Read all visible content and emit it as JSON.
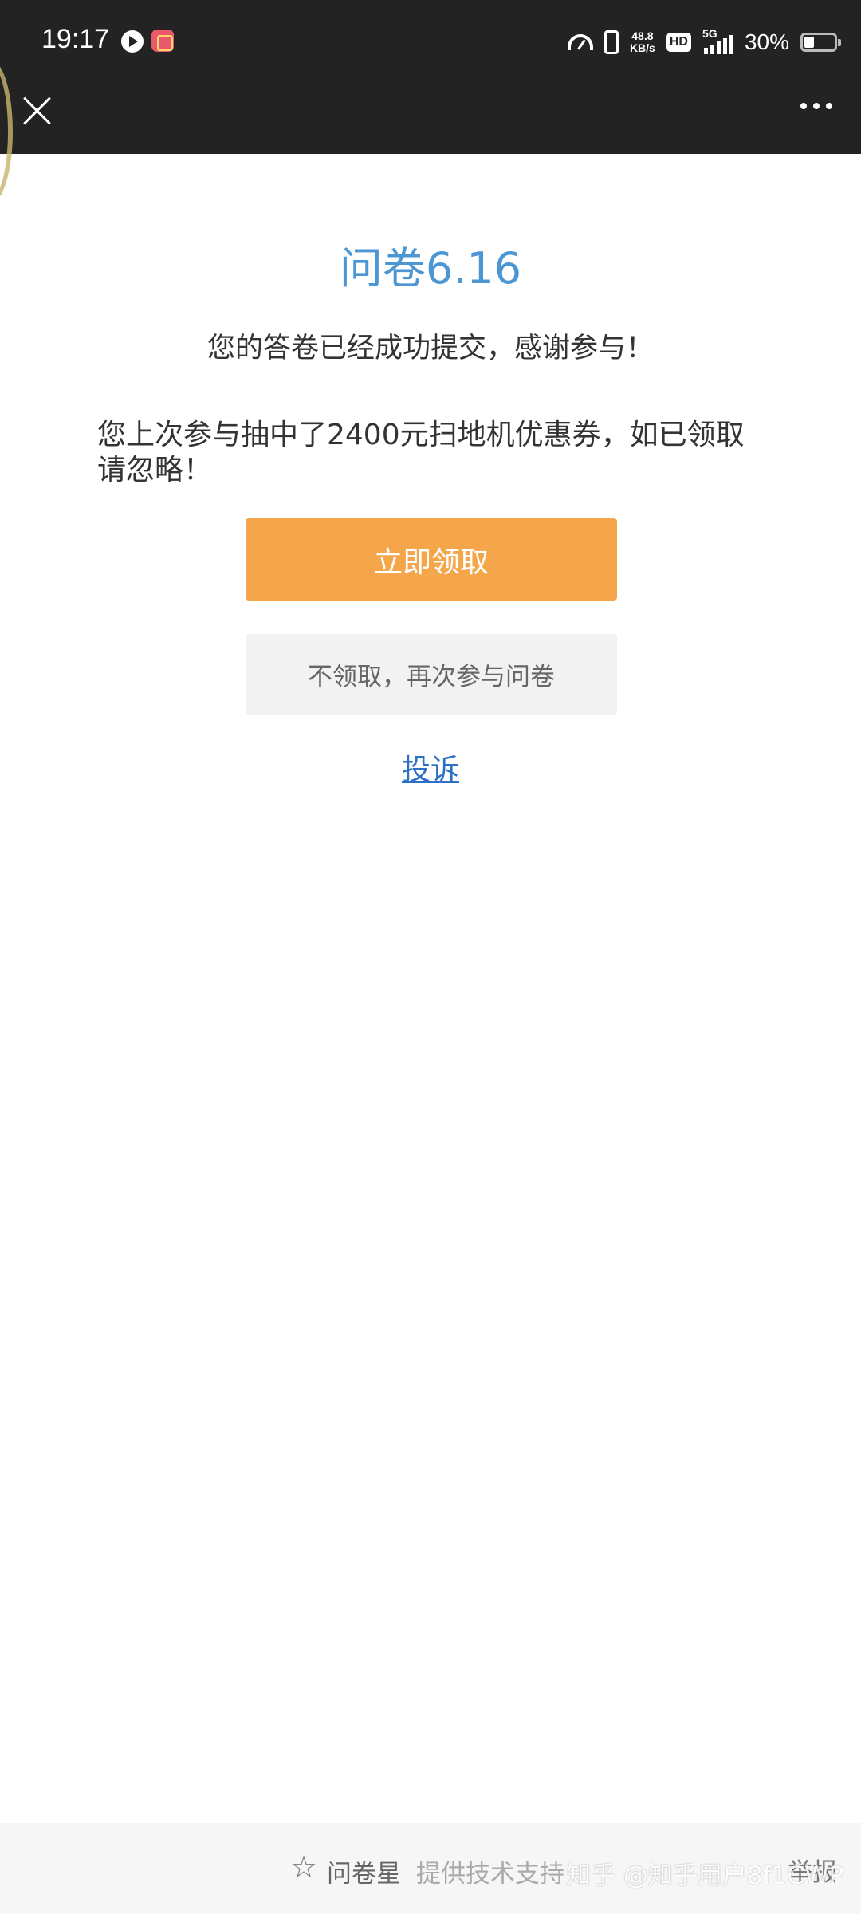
{
  "status_bar": {
    "time": "19:17",
    "net_speed_value": "48.8",
    "net_speed_unit": "KB/s",
    "hd_label": "HD",
    "network_type": "5G",
    "battery": "30%"
  },
  "page": {
    "title": "问卷6.16",
    "success_message": "您的答卷已经成功提交，感谢参与！",
    "notice_line1": "您上次参与抽中了2400元扫地机优惠券，如已领取",
    "notice_line2": "请忽略！",
    "claim_button": "立即领取",
    "retry_button": "不领取，再次参与问卷",
    "complain_link": "投诉"
  },
  "footer": {
    "brand": "问卷星",
    "support": "提供技术支持",
    "report": "举报",
    "watermark": "知乎 @知乎用户8f1CWP"
  },
  "colors": {
    "title": "#4b96d3",
    "claim_button": "#f5a54a",
    "link": "#2e6fc7",
    "bar": "#232323"
  }
}
